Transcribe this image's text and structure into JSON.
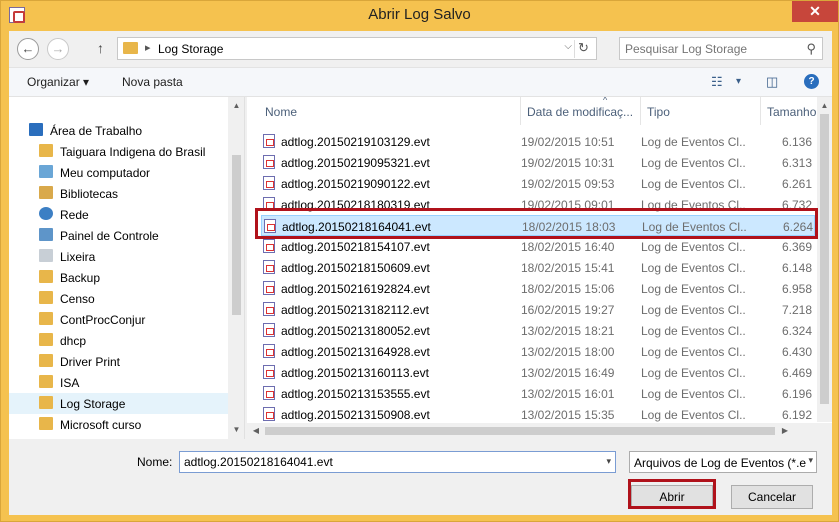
{
  "window": {
    "title": "Abrir Log Salvo",
    "close_glyph": "✕"
  },
  "nav": {
    "back_glyph": "←",
    "forward_glyph": "→",
    "up_glyph": "↑",
    "crumb_sep": "▸",
    "crumb": "Log Storage",
    "addr_dropdown": "⌵",
    "refresh_glyph": "↻",
    "search_placeholder": "Pesquisar Log Storage",
    "search_glyph": "⚲"
  },
  "toolbar": {
    "organize": "Organizar",
    "organize_arrow": "▾",
    "new_folder": "Nova pasta",
    "view_glyph": "☷",
    "view_arrow": "▾",
    "pane_glyph": "◫",
    "help_glyph": "?"
  },
  "sidebar": {
    "items": [
      {
        "label": "Área de Trabalho",
        "icon": "desk",
        "indent": 0
      },
      {
        "label": "Taiguara Indigena do Brasil",
        "icon": "folder",
        "indent": 1
      },
      {
        "label": "Meu computador",
        "icon": "pc",
        "indent": 1
      },
      {
        "label": "Bibliotecas",
        "icon": "lib",
        "indent": 1
      },
      {
        "label": "Rede",
        "icon": "net",
        "indent": 1
      },
      {
        "label": "Painel de Controle",
        "icon": "cp",
        "indent": 1
      },
      {
        "label": "Lixeira",
        "icon": "trash",
        "indent": 1
      },
      {
        "label": "Backup",
        "icon": "folder",
        "indent": 1
      },
      {
        "label": "Censo",
        "icon": "folder",
        "indent": 1
      },
      {
        "label": "ContProcConjur",
        "icon": "folder",
        "indent": 1
      },
      {
        "label": "dhcp",
        "icon": "folder",
        "indent": 1
      },
      {
        "label": "Driver Print",
        "icon": "folder",
        "indent": 1
      },
      {
        "label": "ISA",
        "icon": "folder",
        "indent": 1
      },
      {
        "label": "Log Storage",
        "icon": "folder",
        "indent": 1,
        "selected": true
      },
      {
        "label": "Microsoft curso",
        "icon": "folder",
        "indent": 1
      }
    ],
    "scroll_up": "▲",
    "scroll_down": "▼"
  },
  "columns": {
    "name": "Nome",
    "date": "Data de modificaç...",
    "type": "Tipo",
    "size": "Tamanho",
    "sort_glyph": "^"
  },
  "files": [
    {
      "name": "adtlog.20150219103129.evt",
      "date": "19/02/2015 10:51",
      "type": "Log de Eventos Cl...",
      "size": "6.136"
    },
    {
      "name": "adtlog.20150219095321.evt",
      "date": "19/02/2015 10:31",
      "type": "Log de Eventos Cl...",
      "size": "6.313"
    },
    {
      "name": "adtlog.20150219090122.evt",
      "date": "19/02/2015 09:53",
      "type": "Log de Eventos Cl...",
      "size": "6.261"
    },
    {
      "name": "adtlog.20150218180319.evt",
      "date": "19/02/2015 09:01",
      "type": "Log de Eventos Cl...",
      "size": "6.732"
    },
    {
      "name": "adtlog.20150218164041.evt",
      "date": "18/02/2015 18:03",
      "type": "Log de Eventos Cl...",
      "size": "6.264",
      "selected": true
    },
    {
      "name": "adtlog.20150218154107.evt",
      "date": "18/02/2015 16:40",
      "type": "Log de Eventos Cl...",
      "size": "6.369"
    },
    {
      "name": "adtlog.20150218150609.evt",
      "date": "18/02/2015 15:41",
      "type": "Log de Eventos Cl...",
      "size": "6.148"
    },
    {
      "name": "adtlog.20150216192824.evt",
      "date": "18/02/2015 15:06",
      "type": "Log de Eventos Cl...",
      "size": "6.958"
    },
    {
      "name": "adtlog.20150213182112.evt",
      "date": "16/02/2015 19:27",
      "type": "Log de Eventos Cl...",
      "size": "7.218"
    },
    {
      "name": "adtlog.20150213180052.evt",
      "date": "13/02/2015 18:21",
      "type": "Log de Eventos Cl...",
      "size": "6.324"
    },
    {
      "name": "adtlog.20150213164928.evt",
      "date": "13/02/2015 18:00",
      "type": "Log de Eventos Cl...",
      "size": "6.430"
    },
    {
      "name": "adtlog.20150213160113.evt",
      "date": "13/02/2015 16:49",
      "type": "Log de Eventos Cl...",
      "size": "6.469"
    },
    {
      "name": "adtlog.20150213153555.evt",
      "date": "13/02/2015 16:01",
      "type": "Log de Eventos Cl...",
      "size": "6.196"
    },
    {
      "name": "adtlog.20150213150908.evt",
      "date": "13/02/2015 15:35",
      "type": "Log de Eventos Cl...",
      "size": "6.192"
    }
  ],
  "hscroll": {
    "left": "◀",
    "right": "▶"
  },
  "bottom": {
    "name_label": "Nome:",
    "filename": "adtlog.20150218164041.evt",
    "filetype": "Arquivos de Log de Eventos (*.e",
    "dropdown_glyph": "▾",
    "open": "Abrir",
    "cancel": "Cancelar"
  },
  "colors": {
    "title_bg": "#f5c24f",
    "highlight": "#b0121b",
    "selected_row": "#cce8ff"
  }
}
